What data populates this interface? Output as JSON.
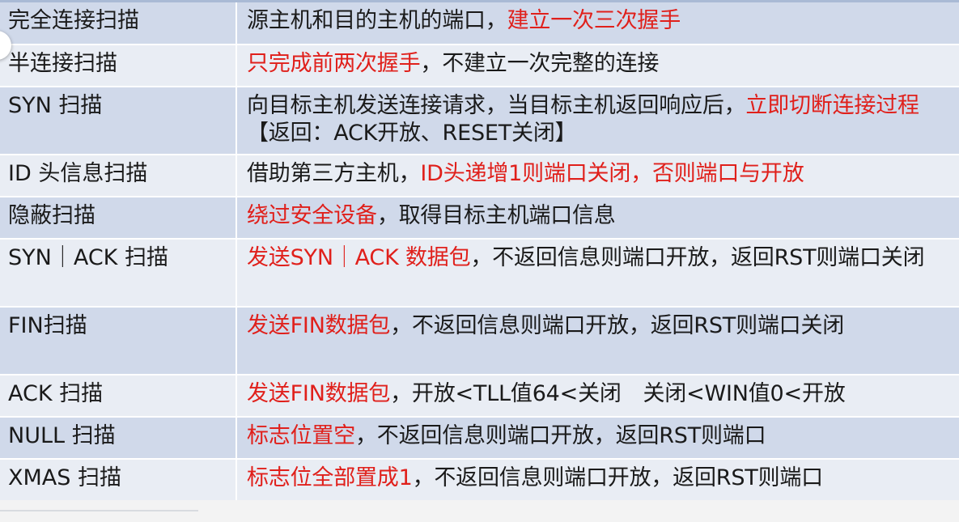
{
  "rows": [
    {
      "name": "完全连接扫描",
      "desc": [
        {
          "text": "源主机和目的主机的端口，",
          "hl": false
        },
        {
          "text": "建立一次三次握手",
          "hl": true
        }
      ]
    },
    {
      "name": "半连接扫描",
      "desc": [
        {
          "text": "只完成前两次握手",
          "hl": true
        },
        {
          "text": "，不建立一次完整的连接",
          "hl": false
        }
      ]
    },
    {
      "name": "SYN 扫描",
      "desc": [
        {
          "text": "向目标主机发送连接请求，当目标主机返回响应后，",
          "hl": false
        },
        {
          "text": "立即切断连接过程",
          "hl": true
        },
        {
          "text": "【返回：ACK开放、RESET关闭】",
          "hl": false
        }
      ]
    },
    {
      "name": "ID 头信息扫描",
      "desc": [
        {
          "text": "借助第三方主机，",
          "hl": false
        },
        {
          "text": "ID头递增1则端口关闭，否则端口与开放",
          "hl": true
        }
      ]
    },
    {
      "name": "隐蔽扫描",
      "desc": [
        {
          "text": "绕过安全设备",
          "hl": true
        },
        {
          "text": "，取得目标主机端口信息",
          "hl": false
        }
      ]
    },
    {
      "name": "SYN｜ACK 扫描",
      "desc": [
        {
          "text": "发送SYN｜ACK 数据包",
          "hl": true
        },
        {
          "text": "，不返回信息则端口开放，返回RST则端口关闭",
          "hl": false
        }
      ]
    },
    {
      "name": "FIN扫描",
      "desc": [
        {
          "text": "发送FIN数据包",
          "hl": true
        },
        {
          "text": "，不返回信息则端口开放，返回RST则端口关闭",
          "hl": false
        }
      ]
    },
    {
      "name": "ACK 扫描",
      "desc": [
        {
          "text": "发送FIN数据包",
          "hl": true
        },
        {
          "text": "，开放<TLL值64<关闭　关闭<WIN值0<开放",
          "hl": false
        }
      ]
    },
    {
      "name": "NULL 扫描",
      "desc": [
        {
          "text": "标志位置空",
          "hl": true
        },
        {
          "text": "，不返回信息则端口开放，返回RST则端口",
          "hl": false
        }
      ]
    },
    {
      "name": "XMAS 扫描",
      "desc": [
        {
          "text": "标志位全部置成1",
          "hl": true
        },
        {
          "text": "，不返回信息则端口开放，返回RST则端口",
          "hl": false
        }
      ]
    }
  ],
  "colors": {
    "highlight": "#e0201b",
    "text": "#1a1a1a",
    "row_dark": "#d0d9ea",
    "row_light": "#e9edf4"
  }
}
